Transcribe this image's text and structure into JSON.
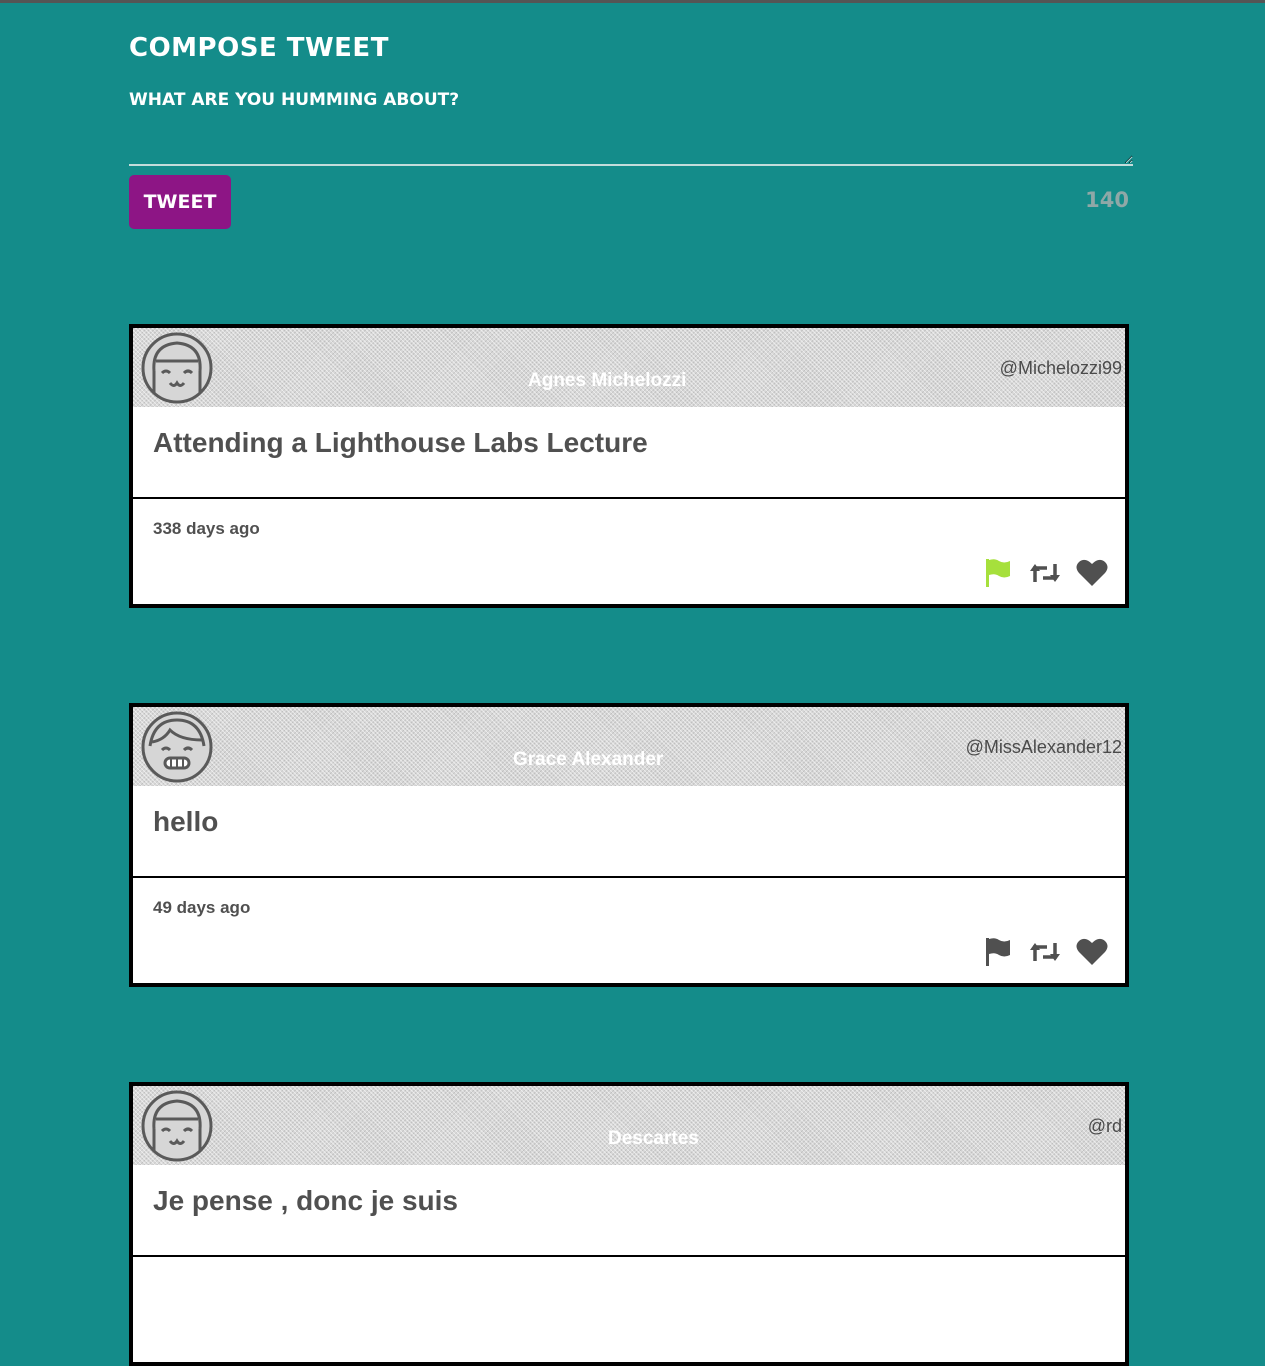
{
  "compose": {
    "title": "Compose Tweet",
    "prompt": "What are you humming about?",
    "input_value": "",
    "tweet_button": "Tweet",
    "counter": "140"
  },
  "tweets": [
    {
      "name": "Agnes Michelozzi",
      "handle": "@Michelozzi99",
      "text": "Attending a Lighthouse Labs Lecture",
      "timestamp": "338 days ago",
      "avatar": "smiling-face-avatar-icon",
      "flagged": true
    },
    {
      "name": "Grace Alexander",
      "handle": "@MissAlexander12",
      "text": "hello",
      "timestamp": "49 days ago",
      "avatar": "grinning-face-avatar-icon",
      "flagged": false
    },
    {
      "name": "Descartes",
      "handle": "@rd",
      "text": "Je pense , donc je suis",
      "timestamp": "",
      "avatar": "smiling-face-avatar-icon",
      "flagged": false
    }
  ],
  "colors": {
    "background": "#148c8a",
    "tweet_button": "#8d1585",
    "flag_active": "#a6e03c",
    "icon_default": "#505050"
  }
}
